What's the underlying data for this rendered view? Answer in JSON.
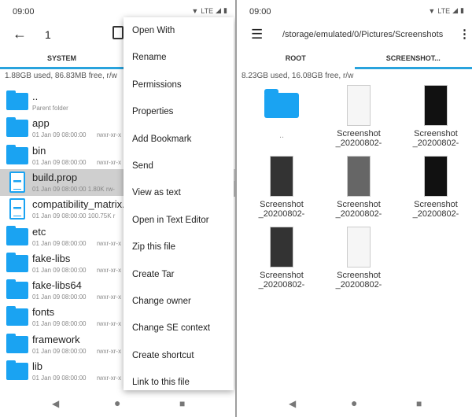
{
  "left": {
    "status": {
      "time": "09:00",
      "network": "LTE"
    },
    "toolbar": {
      "title": "1"
    },
    "tabs": [
      {
        "label": "SYSTEM",
        "active": true
      }
    ],
    "storage_info": "1.88GB used, 86.83MB free, r/w",
    "files": [
      {
        "name": "..",
        "meta": "Parent folder",
        "perm": "",
        "type": "folder"
      },
      {
        "name": "app",
        "meta": "01 Jan 09 08:00:00",
        "perm": "rwxr-xr-x",
        "type": "folder"
      },
      {
        "name": "bin",
        "meta": "01 Jan 09 08:00:00",
        "perm": "rwxr-xr-x",
        "type": "folder"
      },
      {
        "name": "build.prop",
        "meta": "01 Jan 09 08:00:00  1.80K  rw-",
        "perm": "",
        "type": "file",
        "selected": true
      },
      {
        "name": "compatibility_matrix.",
        "meta": "01 Jan 09 08:00:00  100.75K  r",
        "perm": "",
        "type": "file"
      },
      {
        "name": "etc",
        "meta": "01 Jan 09 08:00:00",
        "perm": "rwxr-xr-x",
        "type": "folder"
      },
      {
        "name": "fake-libs",
        "meta": "01 Jan 09 08:00:00",
        "perm": "rwxr-xr-x",
        "type": "folder"
      },
      {
        "name": "fake-libs64",
        "meta": "01 Jan 09 08:00:00",
        "perm": "rwxr-xr-x",
        "type": "folder"
      },
      {
        "name": "fonts",
        "meta": "01 Jan 09 08:00:00",
        "perm": "rwxr-xr-x",
        "type": "folder"
      },
      {
        "name": "framework",
        "meta": "01 Jan 09 08:00:00",
        "perm": "rwxr-xr-x",
        "type": "folder"
      },
      {
        "name": "lib",
        "meta": "01 Jan 09 08:00:00",
        "perm": "rwxr-xr-x",
        "type": "folder"
      }
    ],
    "menu": [
      "Open With",
      "Rename",
      "Permissions",
      "Properties",
      "Add Bookmark",
      "Send",
      "View as text",
      "Open in Text Editor",
      "Zip this file",
      "Create Tar",
      "Change owner",
      "Change SE context",
      "Create shortcut",
      "Link to this file"
    ]
  },
  "right": {
    "status": {
      "time": "09:00",
      "network": "LTE"
    },
    "toolbar": {
      "path": "/storage/emulated/0/Pictures/Screenshots"
    },
    "tabs": [
      {
        "label": "ROOT",
        "active": false
      },
      {
        "label": "SCREENSHOT...",
        "active": true
      }
    ],
    "storage_info": "8.23GB used, 16.08GB free, r/w",
    "parent_label": "..",
    "items": [
      {
        "l1": "Screenshot",
        "l2": "_20200802-",
        "theme": "light"
      },
      {
        "l1": "Screenshot",
        "l2": "_20200802-",
        "theme": "dark"
      },
      {
        "l1": "Screenshot",
        "l2": "_20200802-",
        "theme": "mid"
      },
      {
        "l1": "Screenshot",
        "l2": "_20200802-",
        "theme": "gray"
      },
      {
        "l1": "Screenshot",
        "l2": "_20200802-",
        "theme": "dark"
      },
      {
        "l1": "Screenshot",
        "l2": "_20200802-",
        "theme": "mid"
      },
      {
        "l1": "Screenshot",
        "l2": "_20200802-",
        "theme": "light"
      }
    ],
    "fab": "+"
  },
  "colors": {
    "accent": "#29a3dd",
    "folder": "#1aa3f2",
    "fab": "#0e9e84"
  }
}
